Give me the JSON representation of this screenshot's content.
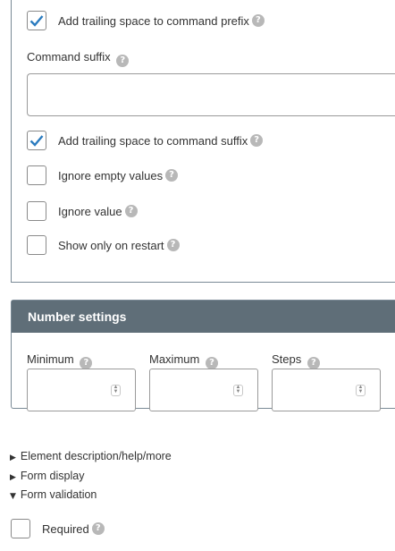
{
  "text_settings": {
    "trailing_prefix_label": "Add trailing space to command prefix",
    "trailing_prefix_checked": true,
    "command_suffix_label": "Command suffix",
    "command_suffix_value": "",
    "trailing_suffix_label": "Add trailing space to command suffix",
    "trailing_suffix_checked": true,
    "ignore_empty_label": "Ignore empty values",
    "ignore_value_label": "Ignore value",
    "show_only_restart_label": "Show only on restart"
  },
  "number_settings": {
    "title": "Number settings",
    "minimum_label": "Minimum",
    "maximum_label": "Maximum",
    "steps_label": "Steps",
    "minimum_value": "",
    "maximum_value": "",
    "steps_value": ""
  },
  "sections": [
    {
      "label": "Element description/help/more",
      "expanded": false
    },
    {
      "label": "Form display",
      "expanded": false
    },
    {
      "label": "Form validation",
      "expanded": true
    }
  ],
  "validation": {
    "required_label": "Required",
    "required_checked": false
  },
  "icons": {
    "help": "question-mark-icon",
    "check": "checkmark-icon",
    "spinner": "spinner-arrows-icon",
    "collapsed": "triangle-right-icon",
    "expanded": "triangle-down-icon"
  },
  "colors": {
    "accent": "#2a7bbf",
    "panel_header": "#5f6e78",
    "help_icon": "#b8b8b8"
  }
}
